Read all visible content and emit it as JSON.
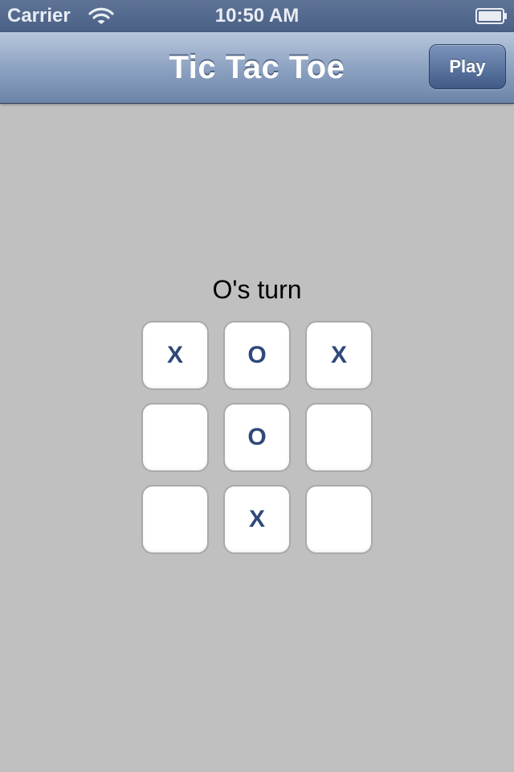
{
  "status_bar": {
    "carrier": "Carrier",
    "time": "10:50 AM",
    "wifi_icon": "wifi-icon",
    "battery_icon": "battery-icon"
  },
  "nav_bar": {
    "title": "Tic Tac Toe",
    "play_label": "Play"
  },
  "game": {
    "turn_text": "O's turn",
    "cells": [
      "X",
      "O",
      "X",
      "",
      "O",
      "",
      "",
      "X",
      ""
    ]
  },
  "colors": {
    "background": "#c0c0c0",
    "nav_gradient_top": "#b7c6dc",
    "nav_gradient_bottom": "#6c84a8",
    "mark_color": "#30497a"
  }
}
